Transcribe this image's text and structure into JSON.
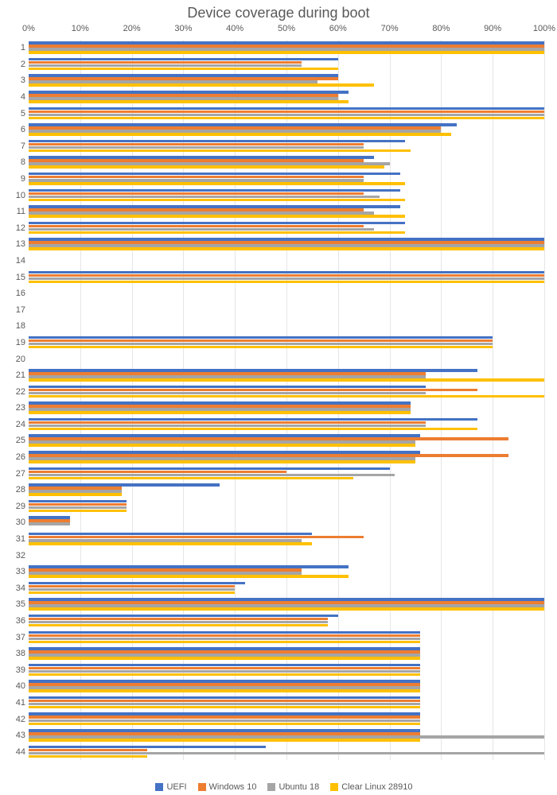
{
  "chart_data": {
    "type": "bar",
    "orientation": "horizontal",
    "title": "Device coverage during boot",
    "xlabel": "",
    "ylabel": "",
    "xlim": [
      0,
      100
    ],
    "x_ticks": [
      0,
      10,
      20,
      30,
      40,
      50,
      60,
      70,
      80,
      90,
      100
    ],
    "x_tick_labels": [
      "0%",
      "10%",
      "20%",
      "30%",
      "40%",
      "50%",
      "60%",
      "70%",
      "80%",
      "90%",
      "100%"
    ],
    "categories": [
      "1",
      "2",
      "3",
      "4",
      "5",
      "6",
      "7",
      "8",
      "9",
      "10",
      "11",
      "12",
      "13",
      "14",
      "15",
      "16",
      "17",
      "18",
      "19",
      "20",
      "21",
      "22",
      "23",
      "24",
      "25",
      "26",
      "27",
      "28",
      "29",
      "30",
      "31",
      "32",
      "33",
      "34",
      "35",
      "36",
      "37",
      "38",
      "39",
      "40",
      "41",
      "42",
      "43",
      "44"
    ],
    "series": [
      {
        "name": "UEFI",
        "color": "#4472C4",
        "values": [
          100,
          60,
          60,
          62,
          100,
          83,
          73,
          67,
          72,
          72,
          72,
          73,
          100,
          0,
          100,
          0,
          0,
          0,
          90,
          0,
          87,
          77,
          74,
          87,
          76,
          76,
          70,
          37,
          19,
          8,
          55,
          0,
          62,
          42,
          100,
          60,
          76,
          76,
          76,
          76,
          76,
          76,
          76,
          46
        ]
      },
      {
        "name": "Windows 10",
        "color": "#ED7D31",
        "values": [
          100,
          53,
          60,
          60,
          100,
          80,
          65,
          65,
          65,
          65,
          65,
          65,
          100,
          0,
          100,
          0,
          0,
          0,
          90,
          0,
          77,
          87,
          74,
          77,
          93,
          93,
          50,
          18,
          19,
          8,
          65,
          0,
          53,
          40,
          100,
          58,
          76,
          76,
          76,
          76,
          76,
          76,
          76,
          23
        ]
      },
      {
        "name": "Ubuntu 18",
        "color": "#A5A5A5",
        "values": [
          100,
          53,
          56,
          60,
          100,
          80,
          65,
          70,
          65,
          68,
          67,
          67,
          100,
          0,
          100,
          0,
          0,
          0,
          90,
          0,
          77,
          77,
          74,
          77,
          75,
          75,
          71,
          18,
          19,
          8,
          53,
          0,
          53,
          40,
          100,
          58,
          76,
          76,
          76,
          76,
          76,
          76,
          100,
          100
        ]
      },
      {
        "name": "Clear Linux 28910",
        "color": "#FFC000",
        "values": [
          100,
          60,
          67,
          62,
          100,
          82,
          74,
          69,
          73,
          73,
          73,
          73,
          100,
          0,
          100,
          0,
          0,
          0,
          90,
          0,
          100,
          100,
          74,
          87,
          75,
          75,
          63,
          18,
          19,
          0,
          55,
          0,
          62,
          40,
          100,
          58,
          76,
          76,
          76,
          76,
          76,
          76,
          76,
          23
        ]
      }
    ],
    "legend_position": "bottom",
    "grid": {
      "x": true,
      "y": false
    }
  }
}
